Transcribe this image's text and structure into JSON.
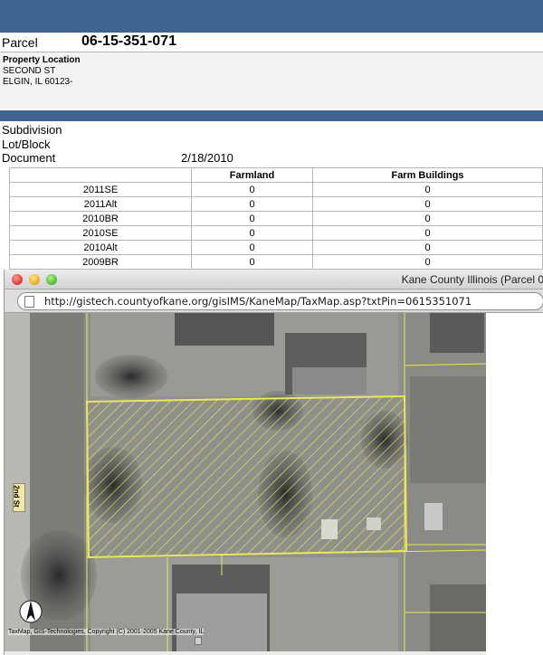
{
  "parcel": {
    "label": "Parcel",
    "number": "06-15-351-071"
  },
  "property_location": {
    "title": "Property Location",
    "line1": "SECOND ST",
    "line2": "ELGIN, IL 60123-"
  },
  "info": {
    "subdivision_label": "Subdivision",
    "lotblock_label": "Lot/Block",
    "document_label": "Document",
    "document_value": "2/18/2010"
  },
  "farm_table": {
    "headers": [
      "",
      "Farmland",
      "Farm Buildings"
    ],
    "rows": [
      [
        "2011SE",
        "0",
        "0"
      ],
      [
        "2011Alt",
        "0",
        "0"
      ],
      [
        "2010BR",
        "0",
        "0"
      ],
      [
        "2010SE",
        "0",
        "0"
      ],
      [
        "2010Alt",
        "0",
        "0"
      ],
      [
        "2009BR",
        "0",
        "0"
      ]
    ]
  },
  "browser": {
    "title": "Kane County Illinois (Parcel 0",
    "url": "http://gistech.countyofkane.org/gisIMS/KaneMap/TaxMap.asp?txtPin=0615351071"
  },
  "map": {
    "street_label": "2nd St",
    "copyright": "TaxMap, GIS-Technologies, Copyright (C) 2001-2005 Kane County, IL",
    "parcel_outline_color": "#e8e85a"
  }
}
